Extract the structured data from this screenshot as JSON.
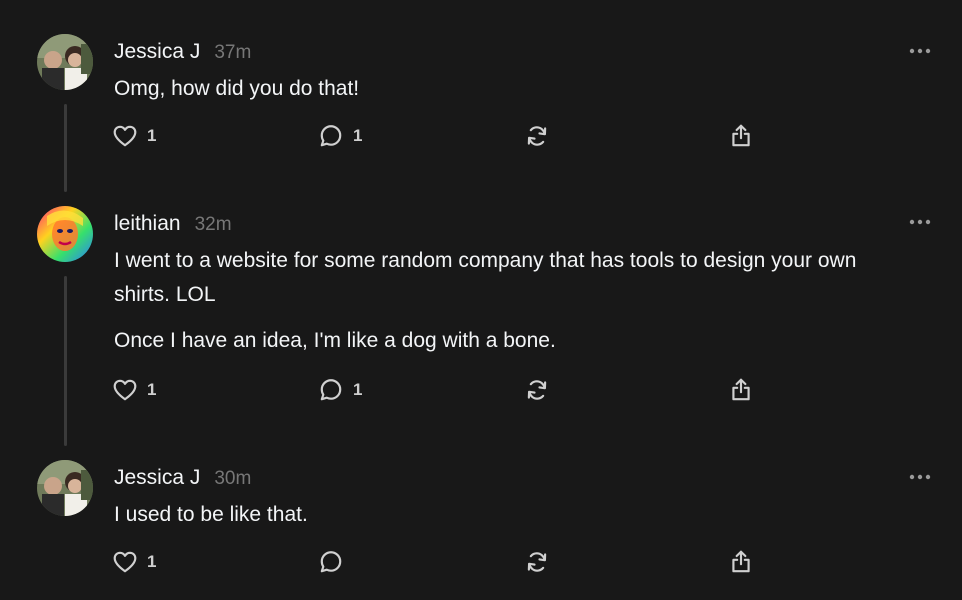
{
  "posts": [
    {
      "username": "Jessica J",
      "time": "37m",
      "paragraphs": [
        "Omg, how did you do that!"
      ],
      "like_count": "1",
      "reply_count": "1"
    },
    {
      "username": "leithian",
      "time": "32m",
      "paragraphs": [
        "I went to a website for some random company that has tools to design your own shirts. LOL",
        "Once I have an idea, I'm like a dog with a bone."
      ],
      "like_count": "1",
      "reply_count": "1"
    },
    {
      "username": "Jessica J",
      "time": "30m",
      "paragraphs": [
        "I used to be like that."
      ],
      "like_count": "1",
      "reply_count": ""
    }
  ],
  "icons": {
    "like": "heart-icon",
    "reply": "comment-icon",
    "repost": "repost-icon",
    "share": "share-icon",
    "more": "more-dots-icon"
  },
  "colors": {
    "background": "#181818",
    "text": "#f3f5f7",
    "muted": "#777777",
    "thread_line": "#3a3a3a"
  }
}
